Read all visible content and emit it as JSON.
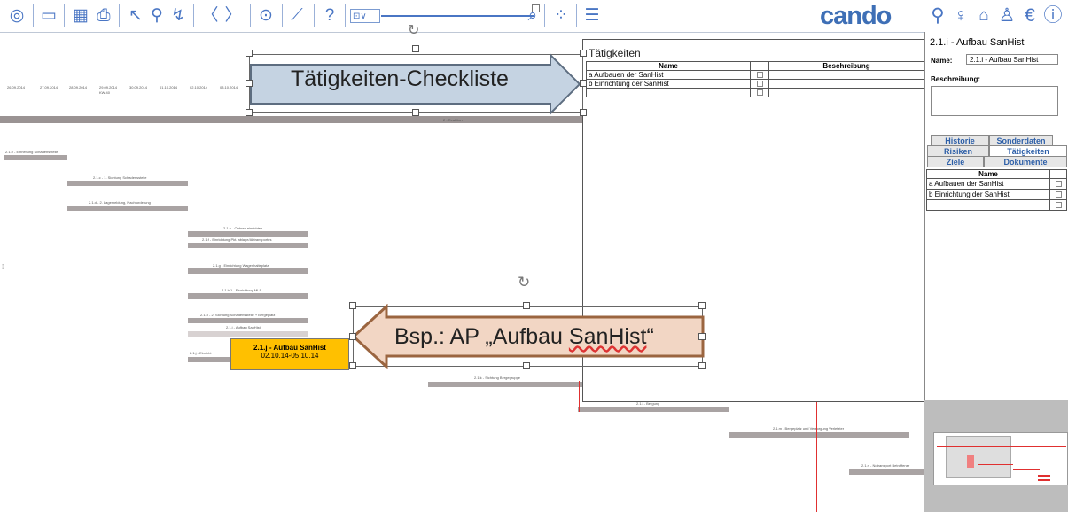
{
  "toolbar": {
    "icons": [
      "eye-icon",
      "comment-icon",
      "chart-icon",
      "print-icon",
      "cursor-icon",
      "zoom-icon",
      "connect-icon",
      "prev-icon",
      "next-icon",
      "play-icon",
      "linechart-icon",
      "help-icon",
      "network-icon",
      "list-icon"
    ],
    "combo_value": "⊡∨",
    "logo": "cando"
  },
  "right_icons": [
    "search-icon",
    "bulb-icon",
    "lock-icon",
    "person-icon",
    "euro-icon",
    "info-icon"
  ],
  "gantt": {
    "dates": [
      "26.09.2014",
      "27.09.2014",
      "28.09.2014",
      "29.09.2014",
      "30.09.2014",
      "01.10.2014",
      "02.10.2014",
      "03.10.2014"
    ],
    "date_sub": "KW 40",
    "bars": [
      {
        "label": "2 - Reaktion"
      },
      {
        "label": "2.1.b - Einheitung Schadensstelle"
      },
      {
        "label": "2.1.c - 1. Sichtung Schadensstelle"
      },
      {
        "label": "2.1.d - 2. Lagemeldung, Nachforderung"
      },
      {
        "label": "2.1.e - Ordnen einrichten"
      },
      {
        "label": "2.1.f - Einrichtung Pkt. ablage/Abtransportes"
      },
      {
        "label": "2.1.g - Einrichtung Wagenhalteplatz"
      },
      {
        "label": "2.1.h.1 - Einrichtung MLS"
      },
      {
        "label": "2.1.h - 2. Sichtung Schadensstelle + Bergeplatz"
      },
      {
        "label": "2.1.i - Aufbau SanHist"
      },
      {
        "label": "2.1.j - Einricht"
      },
      {
        "label": "2.1.k - Sichtung Bergegruppe"
      },
      {
        "label": "2.1.l - Bergung"
      },
      {
        "label": "2.1.m - Bergeplatz und Versorgung Verletzter"
      },
      {
        "label": "2.1.n - Notransport Betroffener"
      }
    ],
    "selected_task": {
      "title": "2.1.j - Aufbau SanHist",
      "dates": "02.10.14-05.10.14"
    }
  },
  "callouts": {
    "top": "Tätigkeiten-Checkliste",
    "bottom_prefix": "Bsp.: AP „Aufbau ",
    "bottom_word": "SanHist",
    "bottom_suffix": "“"
  },
  "activity_panel": {
    "title": "Tätigkeiten",
    "col_name": "Name",
    "col_desc": "Beschreibung",
    "rows": [
      "a Aufbauen der SanHist",
      "b Einrichtung der SanHist",
      ""
    ]
  },
  "side_panel": {
    "header": "2.1.i - Aufbau SanHist",
    "name_label": "Name:",
    "name_value": "2.1.i - Aufbau SanHist",
    "desc_label": "Beschreibung:",
    "tabs_row1": [
      "Historie",
      "Sonderdaten"
    ],
    "tabs_row2": [
      "Risiken",
      "Tätigkeiten"
    ],
    "tabs_row3": [
      "Ziele",
      "Dokumente"
    ],
    "list_header": "Name",
    "rows": [
      "a Aufbauen der SanHist",
      "b Einrichtung der SanHist",
      ""
    ]
  },
  "colors": {
    "accent": "#4a76c4",
    "bar": "#a9a3a3",
    "selected": "#ffc000",
    "arrow_top": "#c5d3e2",
    "arrow_bottom": "#f2d6c4"
  }
}
